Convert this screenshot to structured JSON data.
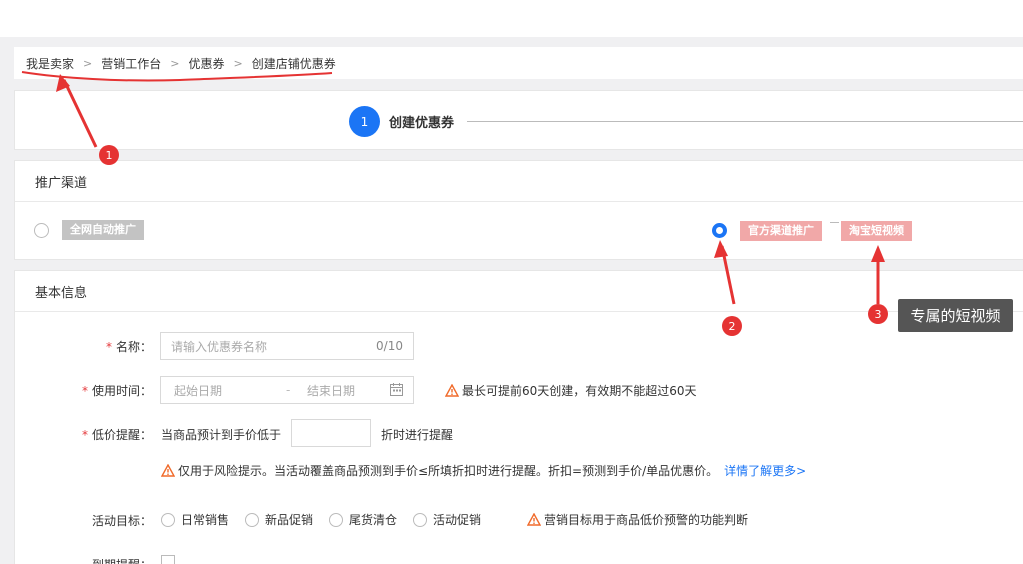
{
  "breadcrumb": {
    "items": [
      "我是卖家",
      "营销工作台",
      "优惠券",
      "创建店铺优惠券"
    ],
    "separator": ">"
  },
  "steps": {
    "current_number": "1",
    "current_label": "创建优惠券"
  },
  "channel": {
    "title": "推广渠道",
    "option_all": "全网自动推广",
    "option_official": "官方渠道推广",
    "option_taobao_video": "淘宝短视频",
    "selected": "official"
  },
  "basic": {
    "title": "基本信息",
    "name": {
      "label": "名称：",
      "placeholder": "请输入优惠券名称",
      "counter": "0/10"
    },
    "time": {
      "label": "使用时间：",
      "start_placeholder": "起始日期",
      "range_sep": "-",
      "end_placeholder": "结束日期",
      "hint": "最长可提前60天创建，有效期不能超过60天"
    },
    "low_price": {
      "label": "低价提醒：",
      "prefix": "当商品预计到手价低于",
      "suffix": "折时进行提醒",
      "hint": "仅用于风险提示。当活动覆盖商品预测到手价≤所填折扣时进行提醒。折扣=预测到手价/单品优惠价。",
      "link": "详情了解更多>"
    },
    "goal": {
      "label": "活动目标：",
      "options": [
        "日常销售",
        "新品促销",
        "尾货清仓",
        "活动促销"
      ],
      "hint": "营销目标用于商品低价预警的功能判断"
    },
    "expire": {
      "label": "到期提醒："
    }
  },
  "annotations": {
    "badge1": "1",
    "badge2": "2",
    "badge3": "3",
    "tooltip": "专属的短视频"
  },
  "colors": {
    "primary": "#1b75f5",
    "danger": "#e53333",
    "tag_pink": "#f1a8a8",
    "tag_grey": "#c3c3c3"
  }
}
